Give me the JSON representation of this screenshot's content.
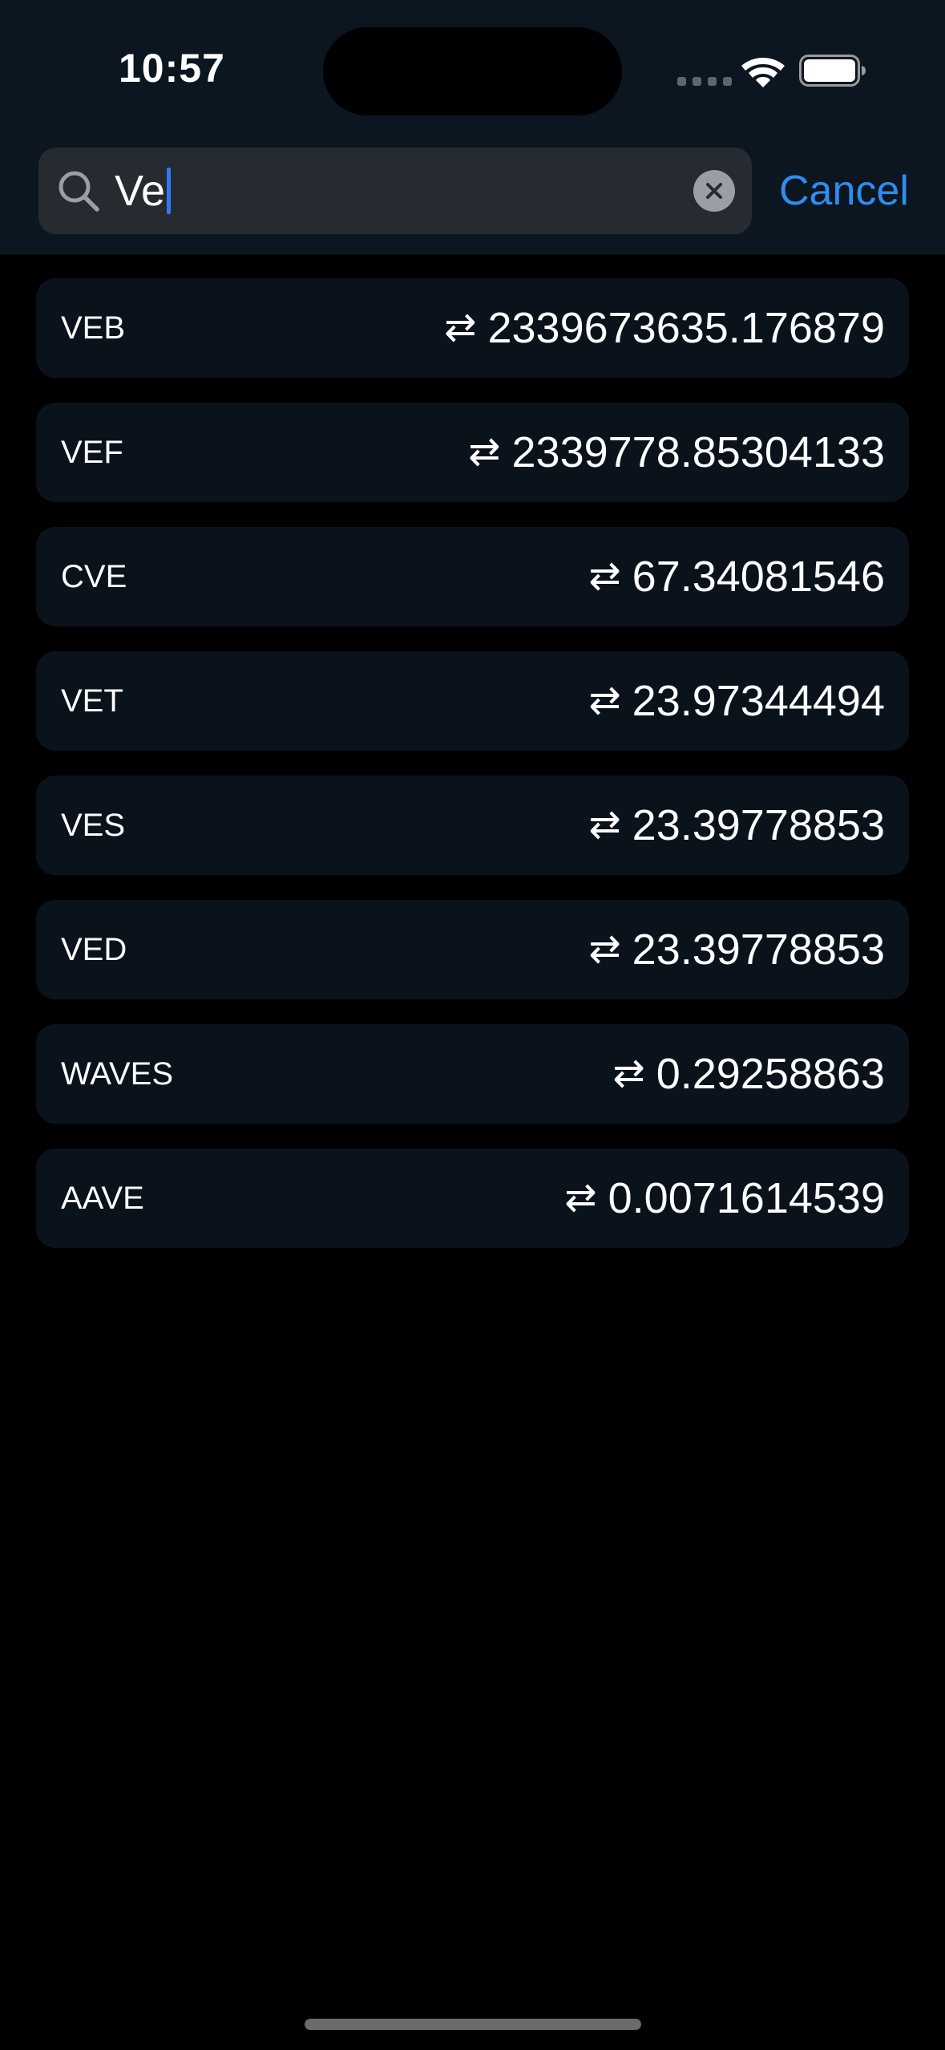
{
  "status_bar": {
    "time": "10:57"
  },
  "search": {
    "query": "Ve",
    "cancel_label": "Cancel"
  },
  "colors": {
    "accent": "#2f8cf0",
    "caret": "#3478f6",
    "row_background": "#0a131c",
    "header_background": "#0c1620",
    "search_field_background": "#262b32"
  },
  "icons": {
    "search": "search-icon",
    "clear": "clear-icon",
    "swap": "swap-icon",
    "wifi": "wifi-icon",
    "battery": "battery-icon"
  },
  "results": [
    {
      "code": "VEB",
      "swap_symbol": "⇄",
      "value": "2339673635.176879"
    },
    {
      "code": "VEF",
      "swap_symbol": "⇄",
      "value": "2339778.85304133"
    },
    {
      "code": "CVE",
      "swap_symbol": "⇄",
      "value": "67.34081546"
    },
    {
      "code": "VET",
      "swap_symbol": "⇄",
      "value": "23.97344494"
    },
    {
      "code": "VES",
      "swap_symbol": "⇄",
      "value": "23.39778853"
    },
    {
      "code": "VED",
      "swap_symbol": "⇄",
      "value": "23.39778853"
    },
    {
      "code": "WAVES",
      "swap_symbol": "⇄",
      "value": "0.29258863"
    },
    {
      "code": "AAVE",
      "swap_symbol": "⇄",
      "value": "0.0071614539"
    }
  ]
}
